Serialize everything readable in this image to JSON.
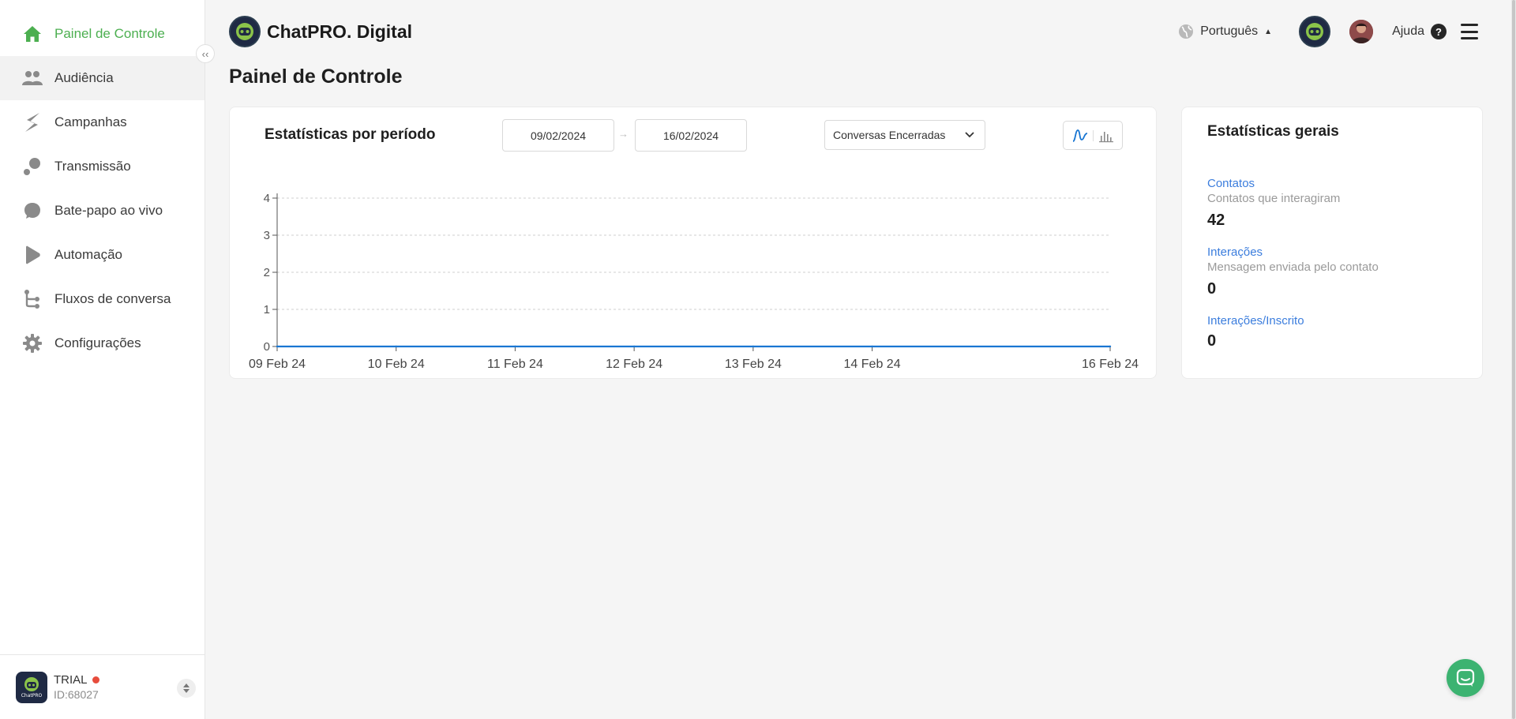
{
  "app": {
    "brand_name": "ChatPRO. Digital"
  },
  "sidebar": {
    "items": [
      {
        "label": "Painel de Controle",
        "icon": "home-icon",
        "active": true
      },
      {
        "label": "Audiência",
        "icon": "users-icon",
        "hover": true
      },
      {
        "label": "Campanhas",
        "icon": "campaign-icon"
      },
      {
        "label": "Transmissão",
        "icon": "broadcast-icon"
      },
      {
        "label": "Bate-papo ao vivo",
        "icon": "chat-icon"
      },
      {
        "label": "Automação",
        "icon": "automation-icon"
      },
      {
        "label": "Fluxos de conversa",
        "icon": "flow-icon"
      },
      {
        "label": "Configurações",
        "icon": "gear-icon"
      }
    ],
    "collapse_glyph": "‹‹",
    "account": {
      "plan": "TRIAL",
      "id": "ID:68027",
      "logo_text": "ChatPRO"
    }
  },
  "header": {
    "language": "Português",
    "help_label": "Ajuda",
    "help_glyph": "?"
  },
  "page": {
    "title": "Painel de Controle"
  },
  "period_card": {
    "title": "Estatísticas por período",
    "start_date": "09/02/2024",
    "end_date": "16/02/2024",
    "date_arrow": "→",
    "metric_select": "Conversas Encerradas",
    "view_mode": "line"
  },
  "general_card": {
    "title": "Estatísticas gerais",
    "stats": [
      {
        "label": "Contatos",
        "description": "Contatos que interagiram",
        "value": "42"
      },
      {
        "label": "Interações",
        "description": "Mensagem enviada pelo contato",
        "value": "0"
      },
      {
        "label": "Interações/Inscrito",
        "description": "",
        "value": "0"
      }
    ]
  },
  "colors": {
    "accent_green": "#4caf50",
    "link_blue": "#3b7ddd",
    "line_blue": "#1976d2",
    "chat_green": "#3cb371"
  },
  "chart_data": {
    "type": "line",
    "x": [
      "09 Feb 24",
      "10 Feb 24",
      "11 Feb 24",
      "12 Feb 24",
      "13 Feb 24",
      "14 Feb 24",
      "16 Feb 24"
    ],
    "x_days": [
      9,
      10,
      11,
      12,
      13,
      14,
      16
    ],
    "series": [
      {
        "values": [
          0,
          0,
          0,
          0,
          0,
          0,
          0
        ]
      }
    ],
    "yticks": [
      0,
      1,
      2,
      3,
      4
    ],
    "ylim": [
      0,
      4
    ],
    "grid": true,
    "title": "",
    "xlabel": "",
    "ylabel": ""
  }
}
